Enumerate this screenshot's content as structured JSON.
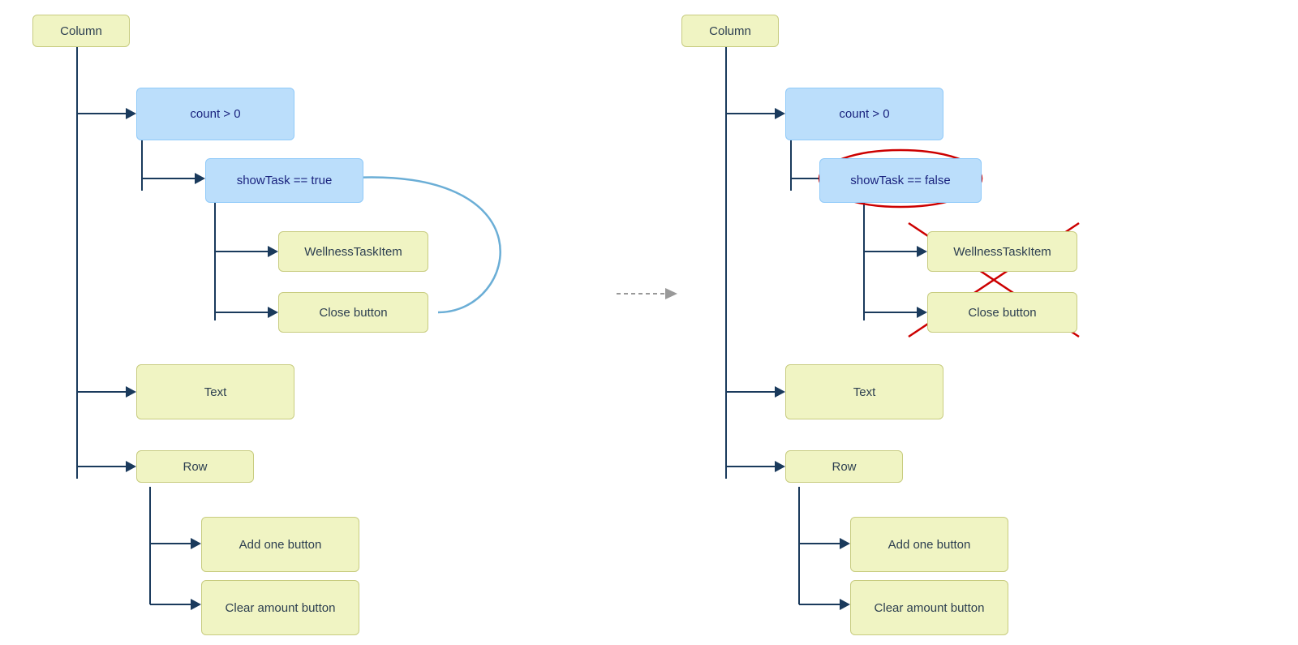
{
  "left_panel": {
    "column_label": "Column",
    "count_label": "count > 0",
    "show_task_label": "showTask == true",
    "wellness_label": "WellnessTaskItem",
    "close_btn_label": "Close button",
    "text_label": "Text",
    "row_label": "Row",
    "add_one_label": "Add one button",
    "clear_label": "Clear amount button"
  },
  "right_panel": {
    "column_label": "Column",
    "count_label": "count > 0",
    "show_task_label": "showTask == false",
    "wellness_label": "WellnessTaskItem",
    "close_btn_label": "Close button",
    "text_label": "Text",
    "row_label": "Row",
    "add_one_label": "Add one button",
    "clear_label": "Clear amount button"
  },
  "arrow_connector": "→",
  "colors": {
    "yellow_bg": "#f0f4c3",
    "blue_bg": "#bbdefb",
    "line": "#1a3a5c",
    "red": "#cc0000",
    "dot_arrow": "#999999"
  }
}
